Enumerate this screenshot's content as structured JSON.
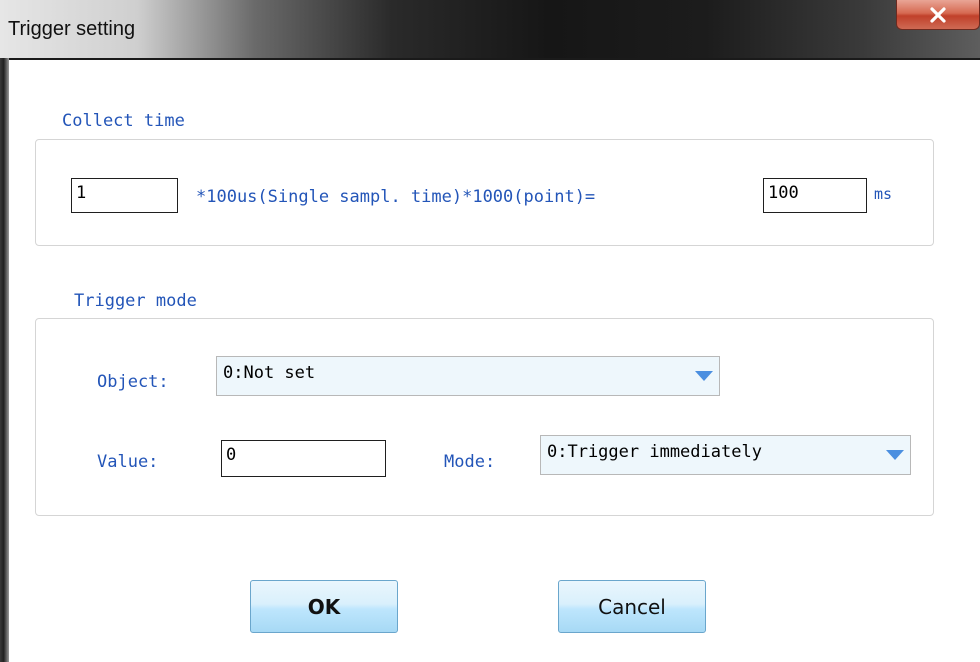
{
  "window": {
    "title": "Trigger setting",
    "close_icon": "close-x-icon"
  },
  "collect_time": {
    "group_label": "Collect time",
    "multiplier_value": "1",
    "formula_text": "*100us(Single sampl. time)*1000(point)=",
    "result_value": "100",
    "unit": "ms"
  },
  "trigger_mode": {
    "group_label": "Trigger mode",
    "object_label": "Object:",
    "object_selected": "0:Not set",
    "value_label": "Value:",
    "value_value": "0",
    "mode_label": "Mode:",
    "mode_selected": "0:Trigger immediately"
  },
  "buttons": {
    "ok_label": "OK",
    "cancel_label": "Cancel"
  },
  "colors": {
    "label_blue": "#2355b8",
    "combo_bg": "#eef7fc",
    "combo_arrow": "#4b8fe0",
    "close_red": "#c9503a"
  }
}
